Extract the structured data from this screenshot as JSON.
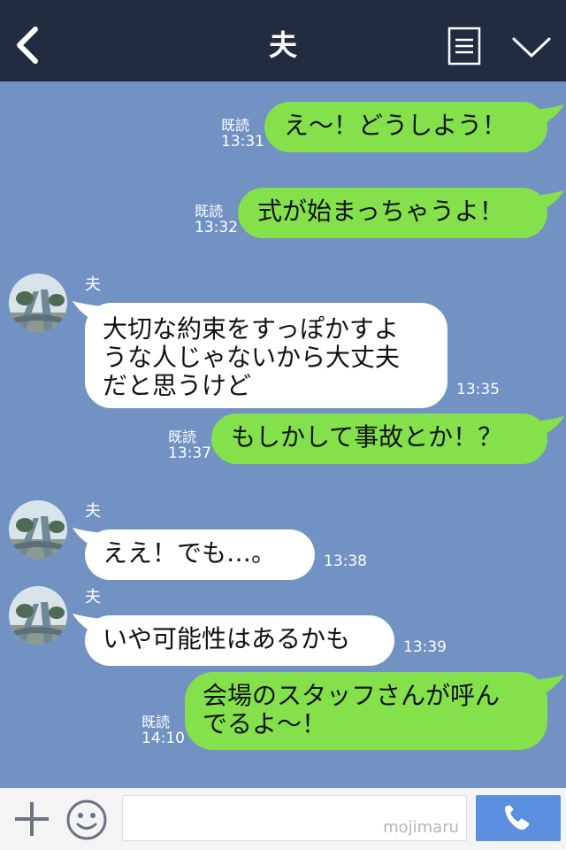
{
  "header": {
    "title": "夫",
    "back_icon": "chevron-left-icon",
    "menu_icon": "list-icon",
    "collapse_icon": "chevron-down-icon"
  },
  "messages": [
    {
      "side": "out",
      "text_lines": [
        "え〜！どうしよう！"
      ],
      "read": "既読",
      "time": "13:31"
    },
    {
      "side": "out",
      "text_lines": [
        "式が始まっちゃうよ！"
      ],
      "read": "既読",
      "time": "13:32"
    },
    {
      "side": "in",
      "sender": "夫",
      "text_lines": [
        "大切な約束をすっぽかすよ",
        "うな人じゃないから大丈夫",
        "だと思うけど"
      ],
      "time": "13:35"
    },
    {
      "side": "out",
      "text_lines": [
        "もしかして事故とか！？"
      ],
      "read": "既読",
      "time": "13:37"
    },
    {
      "side": "in",
      "sender": "夫",
      "text_lines": [
        "ええ！でも…。"
      ],
      "time": "13:38"
    },
    {
      "side": "in",
      "sender": "夫",
      "text_lines": [
        "いや可能性はあるかも"
      ],
      "time": "13:39"
    },
    {
      "side": "out",
      "text_lines": [
        "会場のスタッフさんが呼ん",
        "でるよ〜！"
      ],
      "read": "既読",
      "time": "14:10"
    }
  ],
  "footer": {
    "plus_icon": "plus-icon",
    "emoji_icon": "smiley-icon",
    "input_value": "",
    "watermark": "mojimaru",
    "call_icon": "phone-icon"
  },
  "colors": {
    "header_bg": "#222c41",
    "chat_bg": "#7292c4",
    "outgoing_bubble": "#84e04b",
    "incoming_bubble": "#ffffff",
    "call_button": "#5b8fe0"
  }
}
